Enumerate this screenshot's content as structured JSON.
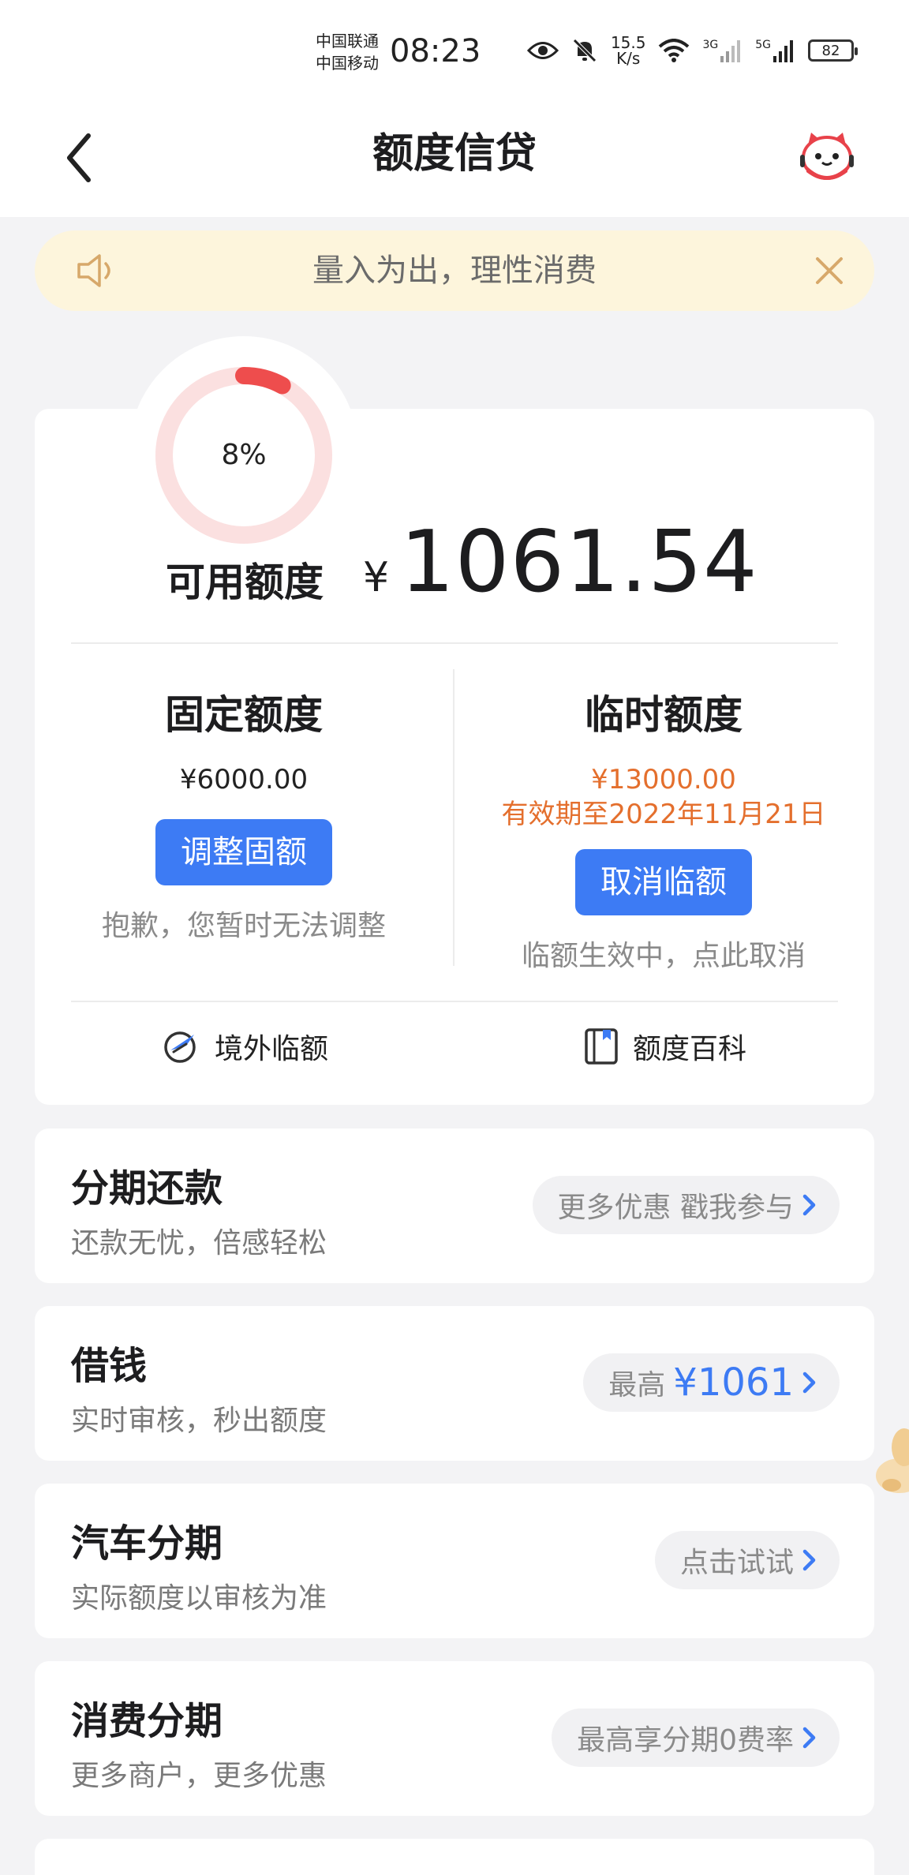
{
  "status_bar": {
    "carrier_1": "中国联通",
    "carrier_2": "中国移动",
    "time": "08:23",
    "net_speed_value": "15.5",
    "net_speed_unit": "K/s",
    "sim1_type": "3G",
    "sim2_type": "5G",
    "battery": "82"
  },
  "header": {
    "title": "额度信贷"
  },
  "notice": {
    "text": "量入为出，理性消费"
  },
  "credit": {
    "usage_percent": 8,
    "usage_label": "8%",
    "available_label": "可用额度",
    "currency": "¥",
    "available_amount": "1061.54",
    "fixed": {
      "label": "固定额度",
      "amount": "¥6000.00",
      "button": "调整固额",
      "hint": "抱歉，您暂时无法调整"
    },
    "temporary": {
      "label": "临时额度",
      "amount": "¥13000.00",
      "validity": "有效期至2022年11月21日",
      "button": "取消临额",
      "hint": "临额生效中，点此取消"
    },
    "links": {
      "overseas": "境外临额",
      "wiki": "额度百科"
    }
  },
  "services": [
    {
      "title": "分期还款",
      "subtitle": "还款无忧，倍感轻松",
      "pill": "更多优惠 戳我参与"
    },
    {
      "title": "借钱",
      "subtitle": "实时审核，秒出额度",
      "pill_prefix": "最高",
      "pill_amount": "¥1061"
    },
    {
      "title": "汽车分期",
      "subtitle": "实际额度以审核为准",
      "pill": "点击试试"
    },
    {
      "title": "消费分期",
      "subtitle": "更多商户，更多优惠",
      "pill": "最高享分期0费率"
    }
  ],
  "colors": {
    "accent_blue": "#3d7bf4",
    "orange": "#e46f2d",
    "ring_red": "#ee4d4d",
    "ring_track": "#fbe0e0",
    "notice_bg": "#fdf5dc"
  }
}
